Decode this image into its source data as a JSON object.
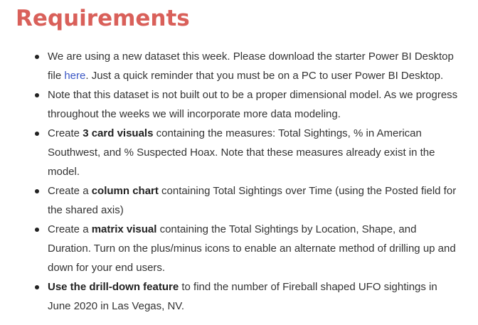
{
  "heading": "Requirements",
  "accent_color": "#d9605a",
  "link_color": "#3b57c4",
  "items": [
    {
      "parts": [
        {
          "text": "We are using a new dataset this week. Please download the starter Power BI Desktop file ",
          "style": "normal"
        },
        {
          "text": "here",
          "style": "link"
        },
        {
          "text": ". Just a quick reminder that you must be on a PC to user Power BI Desktop.",
          "style": "normal"
        }
      ]
    },
    {
      "parts": [
        {
          "text": "Note that this dataset is not built out to be a proper dimensional model. As we progress throughout the weeks we will incorporate more data modeling.",
          "style": "normal"
        }
      ]
    },
    {
      "parts": [
        {
          "text": "Create ",
          "style": "normal"
        },
        {
          "text": "3 card visuals",
          "style": "bold"
        },
        {
          "text": " containing the measures: Total Sightings, % in American Southwest, and % Suspected Hoax. Note that these measures already exist in the model.",
          "style": "normal"
        }
      ]
    },
    {
      "parts": [
        {
          "text": "Create a ",
          "style": "normal"
        },
        {
          "text": "column chart",
          "style": "bold"
        },
        {
          "text": " containing Total Sightings over Time (using the Posted field for the shared axis)",
          "style": "normal"
        }
      ]
    },
    {
      "parts": [
        {
          "text": "Create a ",
          "style": "normal"
        },
        {
          "text": "matrix visual",
          "style": "bold"
        },
        {
          "text": " containing the Total Sightings by Location, Shape, and Duration. Turn on the plus/minus icons to enable an alternate method of drilling up and down for your end users.",
          "style": "normal"
        }
      ]
    },
    {
      "parts": [
        {
          "text": "Use the drill-down feature",
          "style": "bold"
        },
        {
          "text": " to find the number of Fireball shaped UFO sightings in June 2020 in Las Vegas, NV.",
          "style": "normal"
        }
      ]
    }
  ]
}
